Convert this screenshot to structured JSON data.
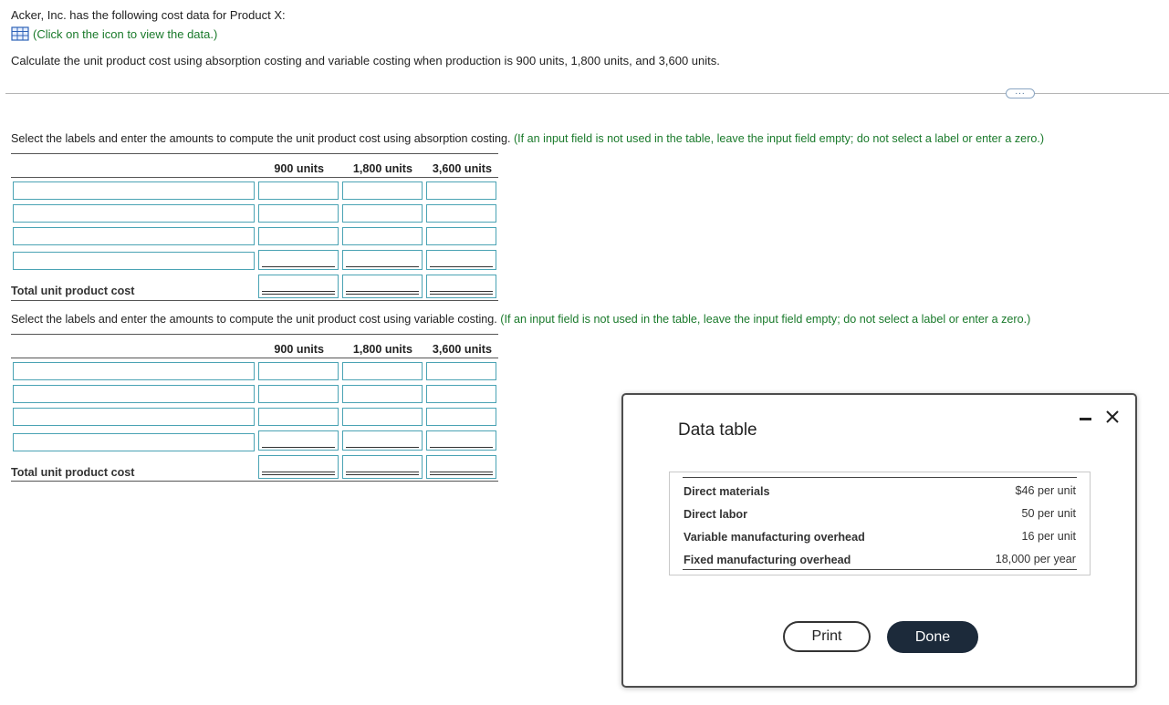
{
  "question": {
    "intro": "Acker, Inc. has the following cost data for Product X:",
    "data_link": "(Click on the icon to view the data.)",
    "task": "Calculate the unit product cost using absorption costing and variable costing when production is 900 units, 1,800 units, and 3,600 units.",
    "more_label": "..."
  },
  "absorption": {
    "instruction": "Select the labels and enter the amounts to compute the unit product cost using absorption costing.",
    "note": "(If an input field is not used in the table, leave the input field empty; do not select a label or enter a zero.)",
    "columns": [
      "900 units",
      "1,800 units",
      "3,600 units"
    ],
    "total_label": "Total unit product cost"
  },
  "variable": {
    "instruction": "Select the labels and enter the amounts to compute the unit product cost using variable costing.",
    "note": "(If an input field is not used in the table, leave the input field empty; do not select a label or enter a zero.)",
    "columns": [
      "900 units",
      "1,800 units",
      "3,600 units"
    ],
    "total_label": "Total unit product cost"
  },
  "data_table": {
    "title": "Data table",
    "rows": [
      {
        "label": "Direct materials",
        "value": "$46 per unit"
      },
      {
        "label": "Direct labor",
        "value": "50 per unit"
      },
      {
        "label": "Variable manufacturing overhead",
        "value": "16 per unit"
      },
      {
        "label": "Fixed manufacturing overhead",
        "value": "18,000 per year"
      }
    ],
    "print_label": "Print",
    "done_label": "Done"
  },
  "colors": {
    "accent_green": "#1a7a2b",
    "input_border": "#4aa3b4",
    "done_button": "#1c2a3a"
  }
}
